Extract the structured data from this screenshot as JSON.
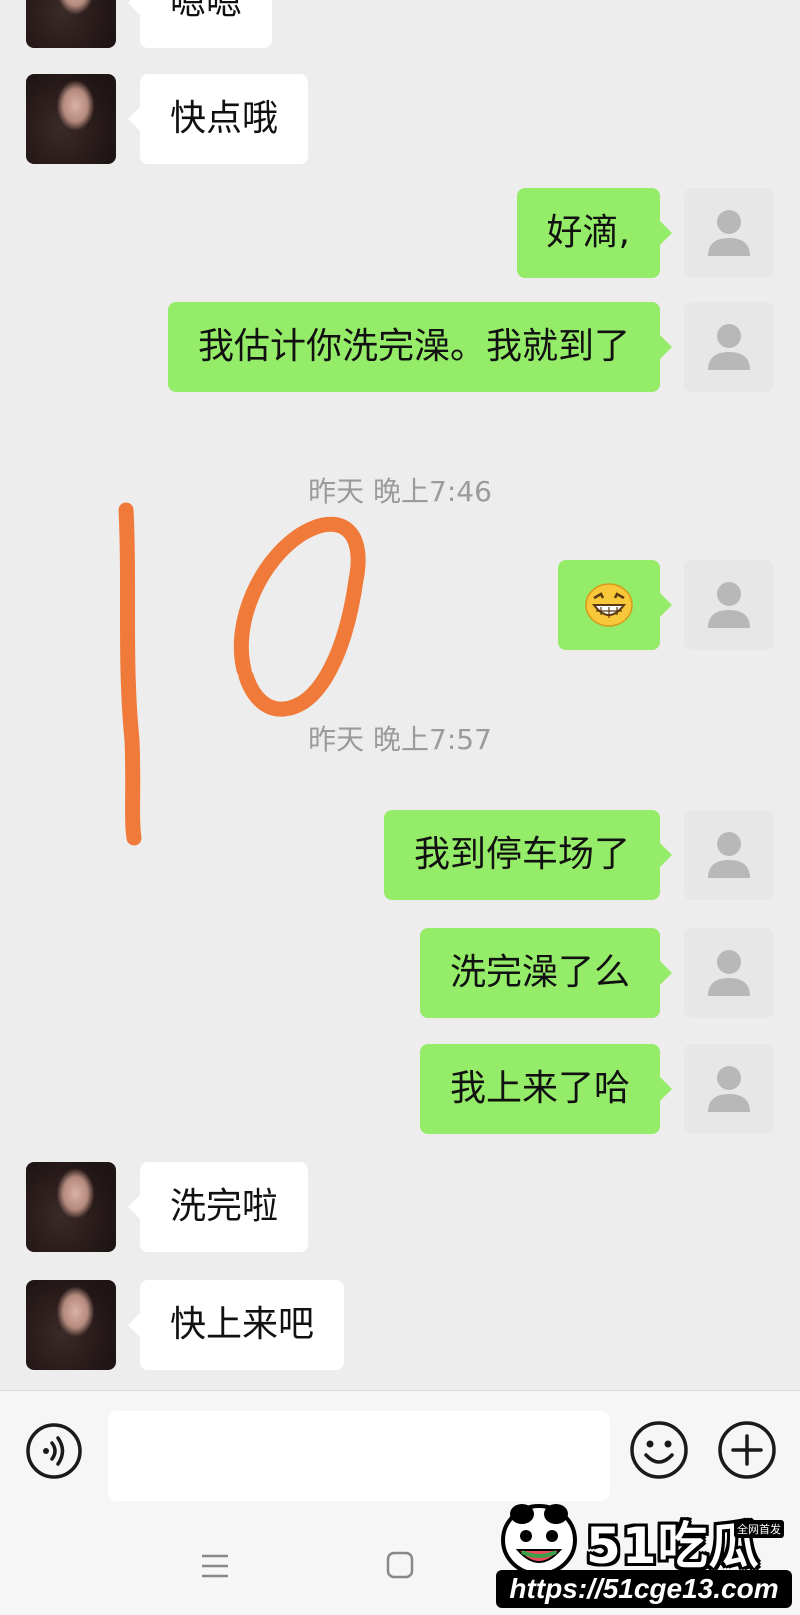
{
  "messages": [
    {
      "sender": "peer",
      "text": "嗯嗯"
    },
    {
      "sender": "peer",
      "text": "快点哦"
    },
    {
      "sender": "self",
      "text": "好滴,"
    },
    {
      "sender": "self",
      "text": "我估计你洗完澡。我就到了"
    },
    {
      "type": "timestamp",
      "text": "昨天 晚上7:46"
    },
    {
      "sender": "self",
      "emoji": "grinning-face-emoji"
    },
    {
      "type": "timestamp",
      "text": "昨天 晚上7:57"
    },
    {
      "sender": "self",
      "text": "我到停车场了"
    },
    {
      "sender": "self",
      "text": "洗完澡了么"
    },
    {
      "sender": "self",
      "text": "我上来了哈"
    },
    {
      "sender": "peer",
      "text": "洗完啦"
    },
    {
      "sender": "peer",
      "text": "快上来吧"
    }
  ],
  "annotation": {
    "text": "10",
    "color": "#f07a3a"
  },
  "input_bar": {
    "voice_icon": "voice-icon",
    "emoji_icon": "smiley-icon",
    "more_icon": "plus-icon",
    "input_value": ""
  },
  "nav_bar": {
    "menu_icon": "menu-icon",
    "home_icon": "home-square-icon"
  },
  "watermark": {
    "brand": "51吃瓜",
    "tag": "全网首发",
    "url": "https://51cge13.com"
  },
  "colors": {
    "background": "#ededed",
    "self_bubble": "#95ec69",
    "peer_bubble": "#ffffff",
    "timestamp": "#9b9b9b"
  }
}
